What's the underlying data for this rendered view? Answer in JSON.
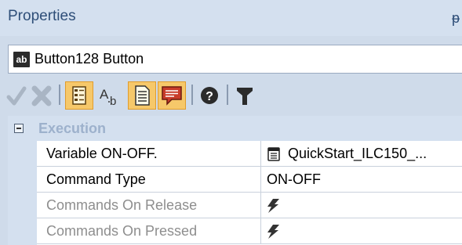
{
  "panel": {
    "title": "Properties",
    "pin_glyph": "ᵽ"
  },
  "selector": {
    "icon_text": "ab",
    "label": "Button128 Button"
  },
  "toolbar": {
    "buttons": [
      {
        "name": "apply-check-icon",
        "state": "disabled"
      },
      {
        "name": "cancel-x-icon",
        "state": "disabled"
      },
      {
        "name": "categorized-view-icon",
        "state": "active"
      },
      {
        "name": "alphabetical-sort-icon",
        "state": "normal"
      },
      {
        "name": "properties-page-icon",
        "state": "active"
      },
      {
        "name": "events-page-icon",
        "state": "active"
      },
      {
        "name": "help-icon",
        "state": "normal"
      },
      {
        "name": "filter-icon",
        "state": "normal"
      }
    ],
    "colors": {
      "active_bg": "#f6c86a",
      "active_border": "#e19c2c"
    }
  },
  "grid": {
    "category": {
      "label": "Execution",
      "expanded": true
    },
    "rows": [
      {
        "name": "Variable ON-OFF.",
        "value": "QuickStart_ILC150_...",
        "value_icon": "variable-icon",
        "enabled": true
      },
      {
        "name": "Command Type",
        "value": "ON-OFF",
        "value_icon": "",
        "enabled": true
      },
      {
        "name": "Commands On Release",
        "value": "",
        "value_icon": "lightning-icon",
        "enabled": false
      },
      {
        "name": "Commands On Pressed",
        "value": "",
        "value_icon": "lightning-icon",
        "enabled": false
      }
    ]
  }
}
